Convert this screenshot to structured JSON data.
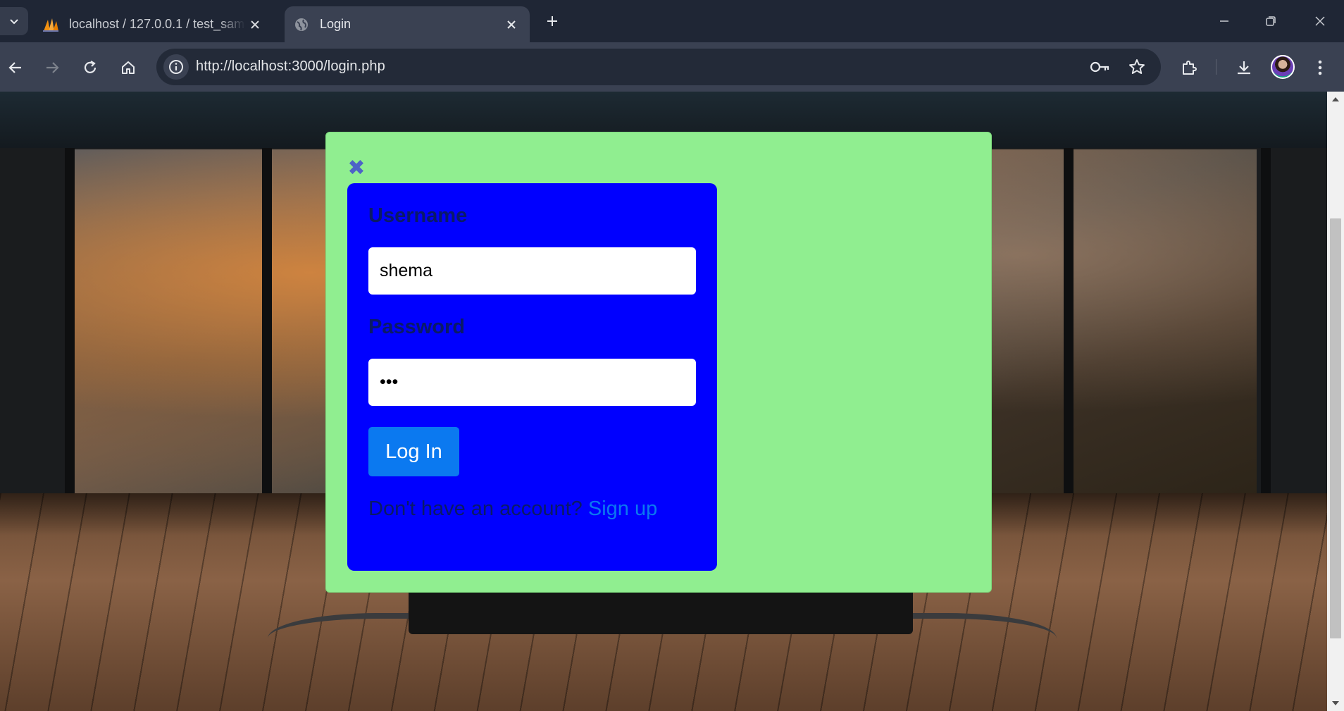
{
  "browser": {
    "tabs": [
      {
        "title": "localhost / 127.0.0.1 / test_samp",
        "active": false,
        "favicon": "phpmyadmin-icon"
      },
      {
        "title": "Login",
        "active": true,
        "favicon": "globe-icon"
      }
    ],
    "url": "http://localhost:3000/login.php"
  },
  "login": {
    "close_glyph": "✖",
    "username_label": "Username",
    "username_value": "shema",
    "password_label": "Password",
    "password_value": "•••",
    "submit_label": "Log In",
    "signup_prompt": "Don't have an account?",
    "signup_link": "Sign up"
  },
  "colors": {
    "modal_bg": "#90ee90",
    "form_bg": "#0000ff",
    "button_bg": "#0b79f0",
    "label_text": "#0a1a66"
  }
}
